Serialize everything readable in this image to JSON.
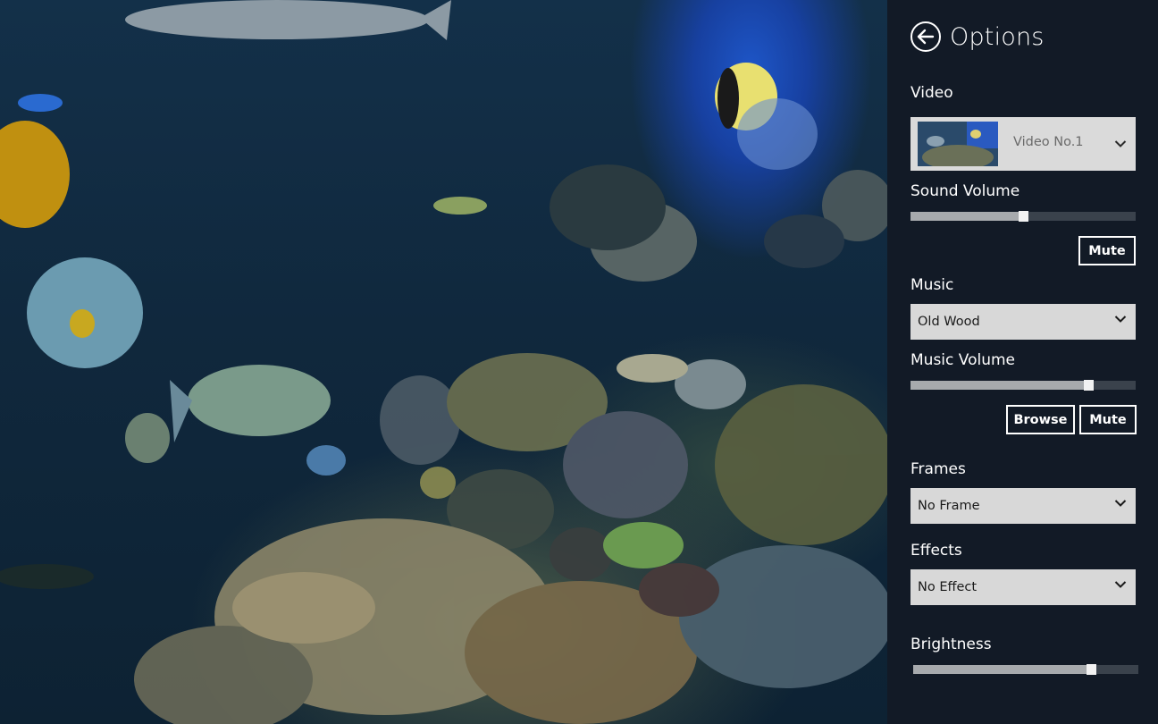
{
  "panel": {
    "title": "Options",
    "video": {
      "label": "Video",
      "selected": "Video No.1"
    },
    "sound_volume": {
      "label": "Sound Volume",
      "level": 0.5,
      "mute_label": "Mute"
    },
    "music": {
      "label": "Music",
      "selected": "Old Wood"
    },
    "music_volume": {
      "label": "Music Volume",
      "level": 0.79,
      "browse_label": "Browse",
      "mute_label": "Mute"
    },
    "frames": {
      "label": "Frames",
      "selected": "No Frame"
    },
    "effects": {
      "label": "Effects",
      "selected": "No Effect"
    },
    "brightness": {
      "label": "Brightness",
      "level": 0.79
    }
  },
  "colors": {
    "panel_bg": "#121a26",
    "dropdown_bg": "#d8d8d8",
    "slider_track": "#3a424c",
    "slider_fill": "#a7aaad",
    "water_blue": "#1e56c8"
  }
}
